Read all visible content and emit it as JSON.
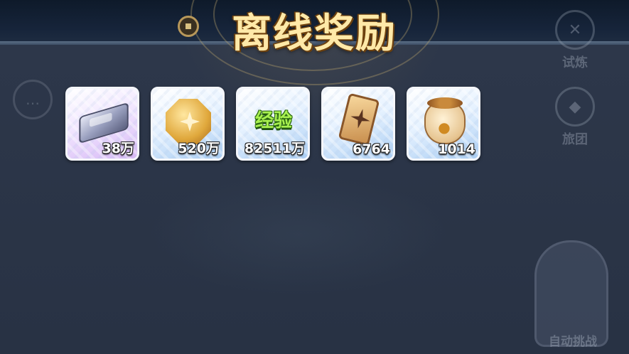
{
  "title": "离线奖励",
  "side_buttons": {
    "trial": {
      "label": "试炼",
      "icon": "sword-icon"
    },
    "guild": {
      "label": "旅团",
      "icon": "guild-crest-icon"
    },
    "auto_battle": {
      "label": "自动挑战"
    }
  },
  "rewards": [
    {
      "name": "silver-ingot",
      "icon": "ingot-icon",
      "quantity": "38万",
      "rarity": "purple"
    },
    {
      "name": "gold-coin",
      "icon": "coin-icon",
      "quantity": "520万",
      "rarity": "blue"
    },
    {
      "name": "experience",
      "icon": "exp-icon",
      "icon_text": "经验",
      "quantity": "82511万",
      "rarity": "blue"
    },
    {
      "name": "card",
      "icon": "card-icon",
      "quantity": "6764",
      "rarity": "blue"
    },
    {
      "name": "pet-food-bag",
      "icon": "paw-bag-icon",
      "quantity": "1014",
      "rarity": "blue"
    }
  ],
  "colors": {
    "overlay": "#2b3547",
    "title": "#ffe9a8",
    "purple_frame": "#d7b8f5",
    "blue_frame": "#a9cdf3",
    "exp_green": "#a8f050"
  }
}
